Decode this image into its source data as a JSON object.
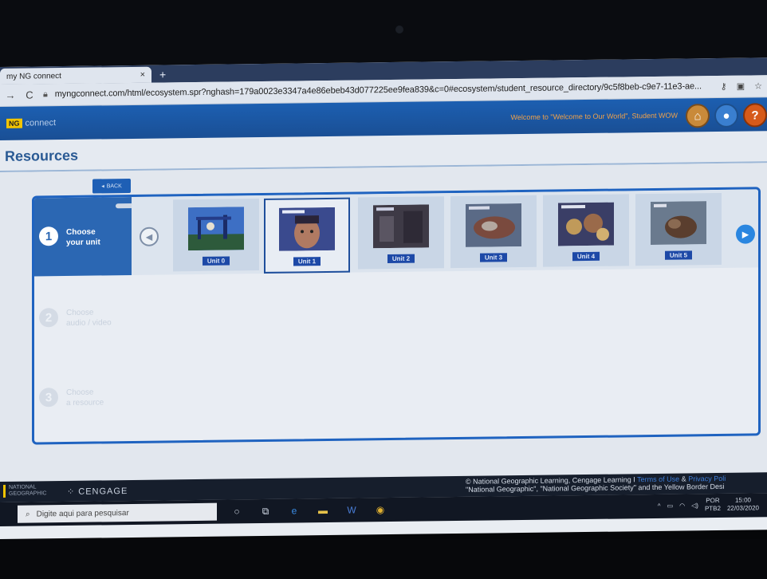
{
  "browser": {
    "tab_title": "my NG connect",
    "tab_close": "×",
    "new_tab": "+",
    "url": "myngconnect.com/html/ecosystem.spr?nghash=179a0023e3347a4e86ebeb43d077225ee9fea839&c=0#ecosystem/student_resource_directory/9c5f8beb-c9e7-11e3-ae..."
  },
  "site": {
    "logo_badge": "NG",
    "logo_text": "connect",
    "welcome": "Welcome to \"Welcome to Our World\", Student WOW"
  },
  "page": {
    "title": "Resources",
    "back_label": "BACK"
  },
  "steps": [
    {
      "num": "1",
      "label_line1": "Choose",
      "label_line2": "your unit"
    },
    {
      "num": "2",
      "label_line1": "Choose",
      "label_line2": "audio / video"
    },
    {
      "num": "3",
      "label_line1": "Choose",
      "label_line2": "a resource"
    }
  ],
  "units": [
    {
      "label": "Unit 0",
      "selected": false
    },
    {
      "label": "Unit 1",
      "selected": true
    },
    {
      "label": "Unit 2",
      "selected": false
    },
    {
      "label": "Unit 3",
      "selected": false
    },
    {
      "label": "Unit 4",
      "selected": false
    },
    {
      "label": "Unit 5",
      "selected": false
    }
  ],
  "footer": {
    "ng_logo_line1": "NATIONAL",
    "ng_logo_line2": "GEOGRAPHIC",
    "cengage": "CENGAGE",
    "copyright_line1": "© National Geographic Learning, Cengage Learning I",
    "terms": "Terms of Use",
    "amp": "&",
    "privacy": "Privacy Poli",
    "copyright_line2": "\"National Geographic\", \"National Geographic Society\" and the Yellow Border Desi"
  },
  "taskbar": {
    "search_placeholder": "Digite aqui para pesquisar",
    "lang_line1": "POR",
    "lang_line2": "PTB2",
    "time": "15:00",
    "date": "22/03/2020"
  },
  "colors": {
    "accent": "#1f63c0",
    "header": "#1c5fb1",
    "unit_label": "#1d49a7"
  }
}
